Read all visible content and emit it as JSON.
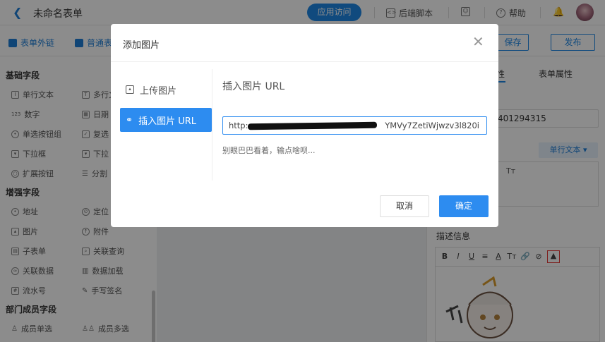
{
  "topbar": {
    "back_icon": "chevron-left-icon",
    "title": "未命名表单",
    "app_visit": "应用访问",
    "backend_script": "后端脚本",
    "help": "帮助"
  },
  "toolbar2": {
    "form_link": "表单外链",
    "normal_form": "普通表",
    "save": "保存",
    "publish": "发布"
  },
  "sidebar": {
    "basic": {
      "title": "基础字段",
      "items": [
        "单行文本",
        "多行文",
        "数字",
        "日期",
        "单选按钮组",
        "复选",
        "下拉框",
        "下拉",
        "扩展按钮",
        "分割"
      ]
    },
    "enhanced": {
      "title": "增强字段",
      "items": [
        "地址",
        "定位",
        "图片",
        "附件",
        "子表单",
        "关联查询",
        "关联数据",
        "数据加载",
        "流水号",
        "手写签名"
      ]
    },
    "dept": {
      "title": "部门成员字段",
      "items": [
        "成员单选",
        "成员多选"
      ]
    },
    "number_icon_text": "123"
  },
  "rightpanel": {
    "tab_field_suffix": "性",
    "tab_form": "表单属性",
    "field_id_value": "401294315",
    "type_select": "单行文本",
    "type_glyph": "Tт",
    "desc_title": "描述信息",
    "editor_tools": [
      "B",
      "I",
      "U",
      "≡",
      "A",
      "Tт"
    ]
  },
  "modal": {
    "title": "添加图片",
    "tabs": [
      {
        "label": "上传图片",
        "icon": "image-icon"
      },
      {
        "label": "插入图片 URL",
        "icon": "link-icon"
      }
    ],
    "section_title": "插入图片 URL",
    "url_value": "http:                                                     YMVy7ZetiWjwzv3l820i",
    "hint": "别眼巴巴看着，输点啥呗...",
    "cancel": "取消",
    "confirm": "确定"
  },
  "colors": {
    "primary": "#2d8cf0",
    "accent_blue": "#1e88e5",
    "highlight_red": "#e53935"
  }
}
